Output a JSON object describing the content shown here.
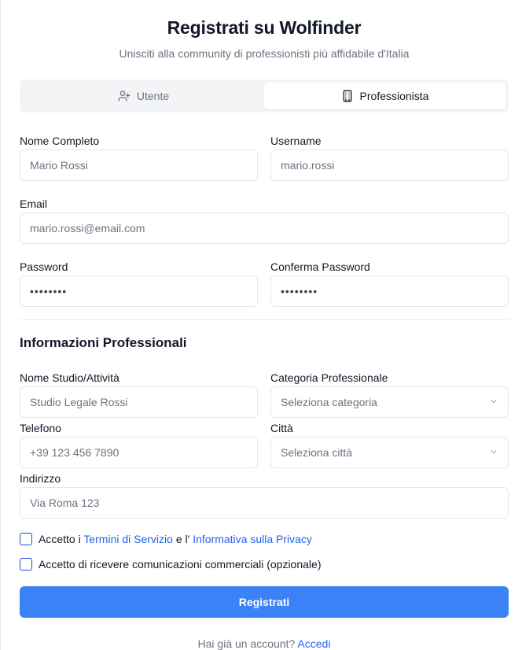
{
  "header": {
    "title": "Registrati su Wolfinder",
    "subtitle": "Unisciti alla community di professionisti più affidabile d'Italia"
  },
  "tabs": [
    {
      "label": "Utente",
      "icon": "user-plus-icon",
      "active": false
    },
    {
      "label": "Professionista",
      "icon": "building-icon",
      "active": true
    }
  ],
  "form": {
    "full_name": {
      "label": "Nome Completo",
      "placeholder": "Mario Rossi"
    },
    "username": {
      "label": "Username",
      "placeholder": "mario.rossi"
    },
    "email": {
      "label": "Email",
      "placeholder": "mario.rossi@email.com"
    },
    "password": {
      "label": "Password",
      "value": "••••••••"
    },
    "confirm_password": {
      "label": "Conferma Password",
      "value": "••••••••"
    }
  },
  "professional": {
    "section_title": "Informazioni Professionali",
    "studio": {
      "label": "Nome Studio/Attività",
      "placeholder": "Studio Legale Rossi"
    },
    "category": {
      "label": "Categoria Professionale",
      "placeholder": "Seleziona categoria"
    },
    "phone": {
      "label": "Telefono",
      "placeholder": "+39 123 456 7890"
    },
    "city": {
      "label": "Città",
      "placeholder": "Seleziona città"
    },
    "address": {
      "label": "Indirizzo",
      "placeholder": "Via Roma 123"
    }
  },
  "consents": {
    "terms_prefix": "Accetto i",
    "terms_link": "Termini di Servizio",
    "terms_middle": "e l'",
    "privacy_link": "Informativa sulla Privacy",
    "marketing": "Accetto di ricevere comunicazioni commerciali (opzionale)"
  },
  "submit_label": "Registrati",
  "footer": {
    "question": "Hai già un account?",
    "login_link": "Accedi"
  },
  "colors": {
    "accent": "#3b82f6",
    "link": "#2563eb"
  }
}
